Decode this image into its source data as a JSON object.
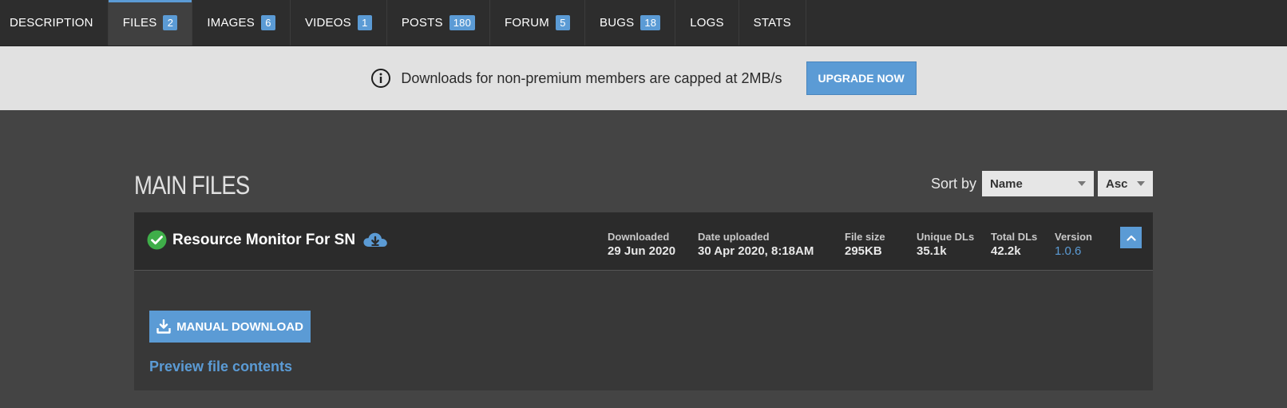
{
  "tabs": [
    {
      "label": "DESCRIPTION",
      "badge": null,
      "active": false
    },
    {
      "label": "FILES",
      "badge": "2",
      "active": true
    },
    {
      "label": "IMAGES",
      "badge": "6",
      "active": false
    },
    {
      "label": "VIDEOS",
      "badge": "1",
      "active": false
    },
    {
      "label": "POSTS",
      "badge": "180",
      "active": false
    },
    {
      "label": "FORUM",
      "badge": "5",
      "active": false
    },
    {
      "label": "BUGS",
      "badge": "18",
      "active": false
    },
    {
      "label": "LOGS",
      "badge": null,
      "active": false
    },
    {
      "label": "STATS",
      "badge": null,
      "active": false
    }
  ],
  "notice": {
    "icon": "info-icon",
    "text": "Downloads for non-premium members are capped at 2MB/s",
    "button_label": "UPGRADE NOW"
  },
  "section": {
    "title": "MAIN FILES",
    "sort_label": "Sort by",
    "sort_field": "Name",
    "sort_order": "Asc"
  },
  "file": {
    "name": "Resource Monitor For SN",
    "status_icon": "check-circle-icon",
    "cloud_icon": "cloud-download-icon",
    "meta": {
      "downloaded": {
        "label": "Downloaded",
        "value": "29 Jun 2020"
      },
      "date_uploaded": {
        "label": "Date uploaded",
        "value": "30 Apr 2020, 8:18AM"
      },
      "file_size": {
        "label": "File size",
        "value": "295KB"
      },
      "unique_dls": {
        "label": "Unique DLs",
        "value": "35.1k"
      },
      "total_dls": {
        "label": "Total DLs",
        "value": "42.2k"
      },
      "version": {
        "label": "Version",
        "value": "1.0.6"
      }
    },
    "manual_download_label": "MANUAL DOWNLOAD",
    "preview_label": "Preview file contents"
  },
  "colors": {
    "accent": "#5b9bd5",
    "tabbar_bg": "#2d2d2d",
    "page_bg": "#444444",
    "notice_bg": "#e1e1e1",
    "success": "#3fae49"
  }
}
